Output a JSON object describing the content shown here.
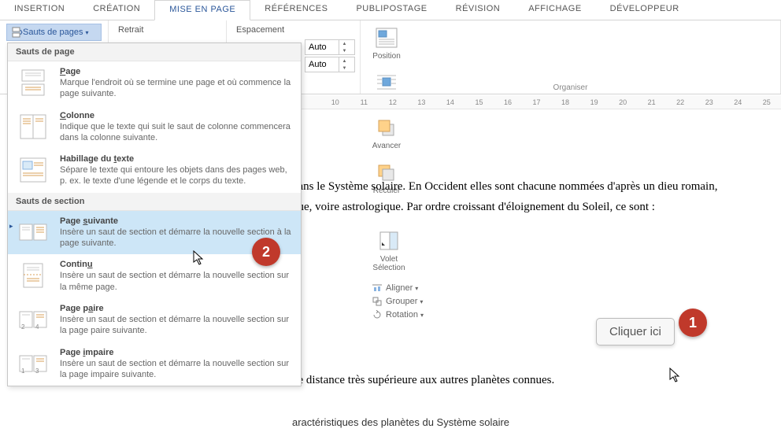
{
  "tabs": [
    "INSERTION",
    "CRÉATION",
    "MISE EN PAGE",
    "RÉFÉRENCES",
    "PUBLIPOSTAGE",
    "RÉVISION",
    "AFFICHAGE",
    "DÉVELOPPEUR"
  ],
  "activeTabIndex": 2,
  "ribbon": {
    "sauts_btn": "Sauts de pages",
    "retrait": "Retrait",
    "espacement": "Espacement",
    "auto1": "Auto",
    "auto2": "Auto",
    "organiser": {
      "position": "Position",
      "habillage": "Habillage",
      "avancer": "Avancer",
      "reculer": "Reculer",
      "volet": "Volet Sélection",
      "aligner": "Aligner",
      "grouper": "Grouper",
      "rotation": "Rotation",
      "group_label": "Organiser"
    }
  },
  "dropdown": {
    "header1": "Sauts de page",
    "items1": [
      {
        "title": "Page",
        "desc": "Marque l'endroit où se termine une page et où commence la page suivante."
      },
      {
        "title": "Colonne",
        "desc": "Indique que le texte qui suit le saut de colonne commencera dans la colonne suivante."
      },
      {
        "title": "Habillage du texte",
        "desc_html": "Sépare le texte qui entoure les objets dans des pages web, p. ex. le texte d'une légende et le corps du texte."
      }
    ],
    "header2": "Sauts de section",
    "items2": [
      {
        "title": "Page suivante",
        "desc": "Insère un saut de section et démarre la nouvelle section à la page suivante.",
        "hover": true
      },
      {
        "title": "Continu",
        "desc": "Insère un saut de section et démarre la nouvelle section sur la même page."
      },
      {
        "title": "Page paire",
        "desc": "Insère un saut de section et démarre la nouvelle section sur la page paire suivante."
      },
      {
        "title": "Page impaire",
        "desc": "Insère un saut de section et démarre la nouvelle section sur la page impaire suivante."
      }
    ]
  },
  "doc": {
    "p1": "dans le Système solaire. En Occident elles sont chacune nommées d'après un dieu romain,",
    "p2": "que, voire astrologique. Par ordre croissant d'éloignement du Soleil, ce sont :",
    "p3": "ne distance très supérieure aux autres planètes connues.",
    "caption": "aractéristiques des planètes du Système solaire"
  },
  "ruler_numbers": [
    "",
    "10",
    "11",
    "12",
    "13",
    "14",
    "15",
    "16",
    "17",
    "18",
    "19",
    "20",
    "21",
    "22",
    "23",
    "24",
    "25"
  ],
  "callout": {
    "tooltip": "Cliquer ici",
    "badge1": "1",
    "badge2": "2"
  }
}
